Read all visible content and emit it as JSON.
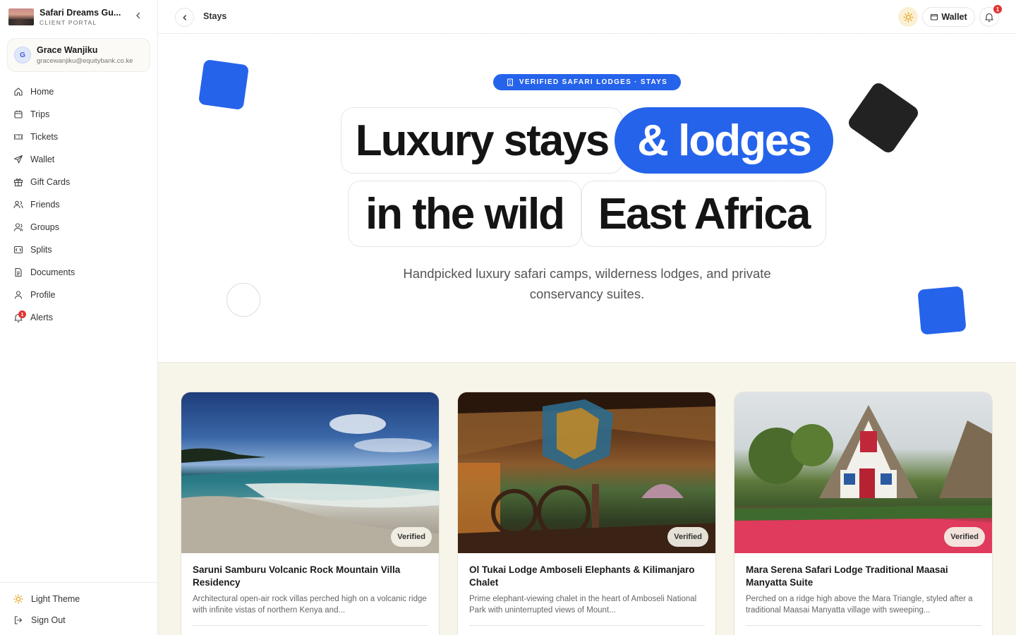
{
  "brand": {
    "name": "Safari Dreams Gu...",
    "subtitle": "CLIENT PORTAL"
  },
  "user": {
    "initial": "G",
    "name": "Grace Wanjiku",
    "email": "gracewanjiku@equitybank.co.ke"
  },
  "nav": {
    "items": [
      {
        "label": "Home",
        "icon": "home-icon"
      },
      {
        "label": "Trips",
        "icon": "calendar-icon"
      },
      {
        "label": "Tickets",
        "icon": "ticket-icon"
      },
      {
        "label": "Wallet",
        "icon": "send-icon"
      },
      {
        "label": "Gift Cards",
        "icon": "gift-icon"
      },
      {
        "label": "Friends",
        "icon": "users-icon"
      },
      {
        "label": "Groups",
        "icon": "user-group-icon"
      },
      {
        "label": "Splits",
        "icon": "split-icon"
      },
      {
        "label": "Documents",
        "icon": "document-icon"
      },
      {
        "label": "Profile",
        "icon": "user-icon"
      },
      {
        "label": "Alerts",
        "icon": "bell-icon",
        "badge": "1"
      }
    ]
  },
  "footer": {
    "theme_label": "Light Theme",
    "signout_label": "Sign Out"
  },
  "topbar": {
    "title": "Stays",
    "wallet_label": "Wallet",
    "notification_count": "1"
  },
  "hero": {
    "pill": "VERIFIED SAFARI LODGES · STAYS",
    "words": [
      "Luxury stays",
      "& lodges",
      "in the wild",
      "East Africa"
    ],
    "subtitle": "Handpicked luxury safari camps, wilderness lodges, and private conservancy suites."
  },
  "listings": [
    {
      "badge": "Verified",
      "title": "Saruni Samburu Volcanic Rock Mountain Villa Residency",
      "description": "Architectural open-air rock villas perched high on a volcanic ridge with infinite vistas of northern Kenya and..."
    },
    {
      "badge": "Verified",
      "title": "Ol Tukai Lodge Amboseli Elephants & Kilimanjaro Chalet",
      "description": "Prime elephant-viewing chalet in the heart of Amboseli National Park with uninterrupted views of Mount..."
    },
    {
      "badge": "Verified",
      "title": "Mara Serena Safari Lodge Traditional Maasai Manyatta Suite",
      "description": "Perched on a ridge high above the Mara Triangle, styled after a traditional Maasai Manyatta village with sweeping..."
    }
  ],
  "colors": {
    "accent": "#2563eb",
    "badge_red": "#e23333",
    "listing_bg": "#f7f4ea"
  }
}
